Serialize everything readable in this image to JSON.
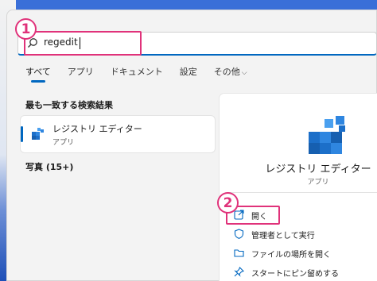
{
  "search": {
    "value": "regedit",
    "icon": "search-icon"
  },
  "annotations": {
    "step1": "1",
    "step2": "2",
    "color": "#e0327a"
  },
  "tabs": [
    {
      "label": "すべて",
      "active": true
    },
    {
      "label": "アプリ"
    },
    {
      "label": "ドキュメント"
    },
    {
      "label": "設定"
    },
    {
      "label": "その他",
      "dropdown": true
    }
  ],
  "results": {
    "best_match_title": "最も一致する検索結果",
    "best_match": {
      "name": "レジストリ エディター",
      "type": "アプリ",
      "icon": "registry-editor-icon"
    },
    "photos_title": "写真 (15+)"
  },
  "detail": {
    "name": "レジストリ エディター",
    "type": "アプリ",
    "icon": "registry-editor-icon",
    "actions": [
      {
        "label": "開く",
        "icon": "open-icon"
      },
      {
        "label": "管理者として実行",
        "icon": "shield-icon"
      },
      {
        "label": "ファイルの場所を開く",
        "icon": "folder-icon"
      },
      {
        "label": "スタートにピン留めする",
        "icon": "pin-icon"
      }
    ]
  },
  "colors": {
    "accent": "#0067c0",
    "annotation": "#e0327a"
  }
}
